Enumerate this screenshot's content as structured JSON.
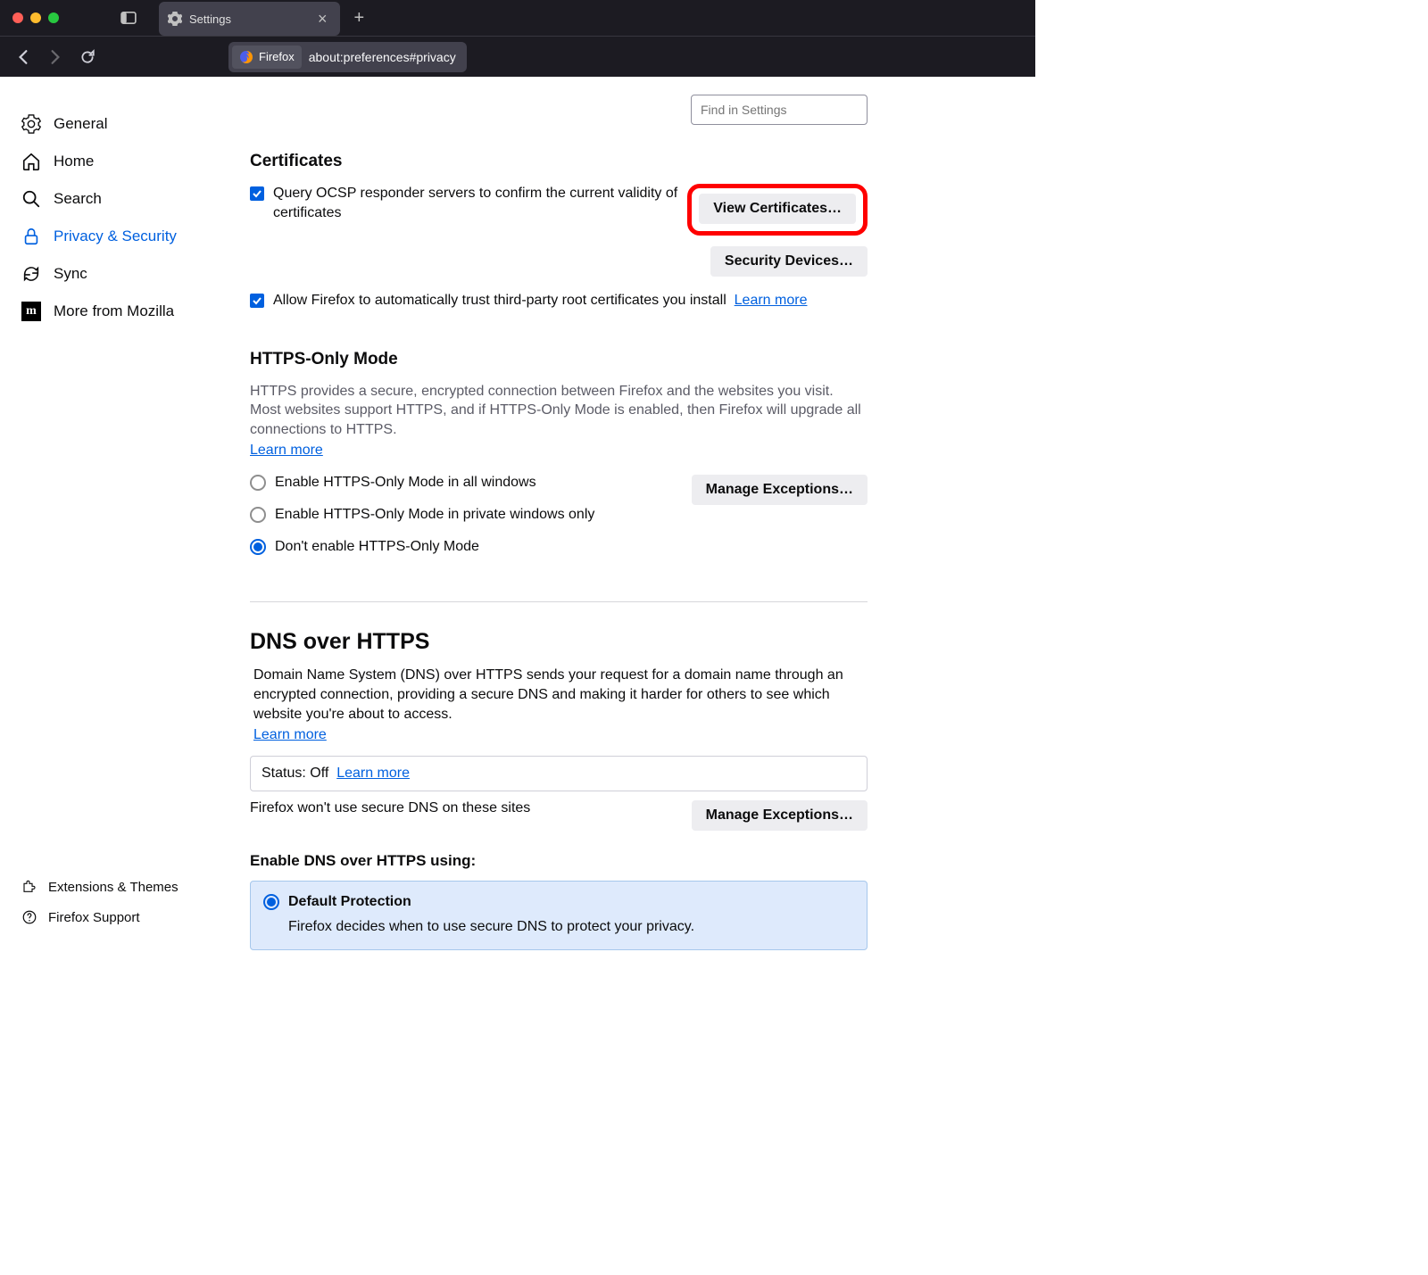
{
  "titlebar": {
    "tab_title": "Settings"
  },
  "toolbar": {
    "url_badge": "Firefox",
    "url": "about:preferences#privacy"
  },
  "search": {
    "placeholder": "Find in Settings"
  },
  "sidebar": {
    "items": [
      {
        "label": "General"
      },
      {
        "label": "Home"
      },
      {
        "label": "Search"
      },
      {
        "label": "Privacy & Security"
      },
      {
        "label": "Sync"
      },
      {
        "label": "More from Mozilla"
      }
    ],
    "bottom": [
      {
        "label": "Extensions & Themes"
      },
      {
        "label": "Firefox Support"
      }
    ]
  },
  "certificates": {
    "title": "Certificates",
    "ocsp_label": "Query OCSP responder servers to confirm the current validity of certificates",
    "auto_trust_label": "Allow Firefox to automatically trust third-party root certificates you install",
    "learn_more": "Learn more",
    "view_btn": "View Certificates…",
    "devices_btn": "Security Devices…"
  },
  "https_only": {
    "title": "HTTPS-Only Mode",
    "desc": "HTTPS provides a secure, encrypted connection between Firefox and the websites you visit. Most websites support HTTPS, and if HTTPS-Only Mode is enabled, then Firefox will upgrade all connections to HTTPS.",
    "learn_more": "Learn more",
    "manage_btn": "Manage Exceptions…",
    "options": [
      "Enable HTTPS-Only Mode in all windows",
      "Enable HTTPS-Only Mode in private windows only",
      "Don't enable HTTPS-Only Mode"
    ]
  },
  "doh": {
    "title": "DNS over HTTPS",
    "desc": "Domain Name System (DNS) over HTTPS sends your request for a domain name through an encrypted connection, providing a secure DNS and making it harder for others to see which website you're about to access.",
    "learn_more": "Learn more",
    "status_label": "Status: Off",
    "status_learn": "Learn more",
    "exception_note": "Firefox won't use secure DNS on these sites",
    "manage_btn": "Manage Exceptions…",
    "enable_title": "Enable DNS over HTTPS using:",
    "default_option": "Default Protection",
    "default_desc": "Firefox decides when to use secure DNS to protect your privacy."
  }
}
